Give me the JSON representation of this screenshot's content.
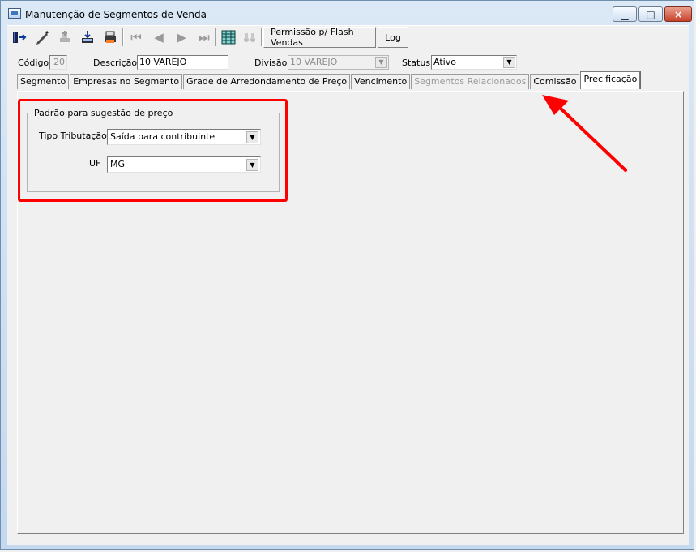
{
  "window": {
    "title": "Manutenção de Segmentos de Venda",
    "controls": [
      "minimize-icon",
      "maximize-icon",
      "close-icon"
    ]
  },
  "toolbar": {
    "buttons": [
      {
        "icon": "exit-icon",
        "enabled": true
      },
      {
        "icon": "edit-icon",
        "enabled": true
      },
      {
        "icon": "new-record-icon",
        "enabled": false
      },
      {
        "icon": "save-icon",
        "enabled": true
      },
      {
        "icon": "print-icon",
        "enabled": true
      },
      {
        "icon": "first-record-icon",
        "enabled": false
      },
      {
        "icon": "previous-record-icon",
        "enabled": false
      },
      {
        "icon": "next-record-icon",
        "enabled": false
      },
      {
        "icon": "last-record-icon",
        "enabled": false
      },
      {
        "icon": "grid-view-icon",
        "enabled": true
      },
      {
        "icon": "binoculars-icon",
        "enabled": false
      }
    ],
    "permission_label": "Permissão p/ Flash Vendas",
    "log_label": "Log"
  },
  "fields": {
    "codigo_label": "Código",
    "codigo_value": "20",
    "descricao_label": "Descrição",
    "descricao_value": "10 VAREJO",
    "divisao_label": "Divisão",
    "divisao_value": "10 VAREJO",
    "status_label": "Status",
    "status_value": "Ativo"
  },
  "tabs": [
    {
      "label": "Segmento",
      "state": "normal"
    },
    {
      "label": "Empresas no Segmento",
      "state": "normal"
    },
    {
      "label": "Grade de Arredondamento de Preço",
      "state": "normal"
    },
    {
      "label": "Vencimento",
      "state": "normal"
    },
    {
      "label": "Segmentos Relacionados",
      "state": "disabled"
    },
    {
      "label": "Comissão",
      "state": "normal"
    },
    {
      "label": "Precificação",
      "state": "active"
    }
  ],
  "group": {
    "title": "Padrão para sugestão de preço",
    "tipo_tributacao_label": "Tipo Tributação",
    "tipo_tributacao_value": "Saída para contribuinte",
    "uf_label": "UF",
    "uf_value": "MG"
  },
  "annotation_color": "#ff0000"
}
